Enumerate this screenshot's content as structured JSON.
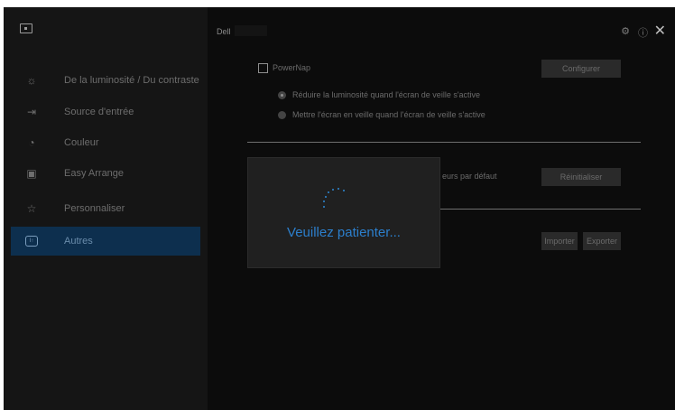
{
  "header": {
    "brand": "Dell"
  },
  "sidebar": {
    "items": [
      {
        "label": "De la luminosité / Du contraste",
        "icon": "brightness-icon"
      },
      {
        "label": "Source d'entrée",
        "icon": "input-source-icon"
      },
      {
        "label": "Couleur",
        "icon": "color-icon"
      },
      {
        "label": "Easy Arrange",
        "icon": "easy-arrange-icon"
      },
      {
        "label": "Personnaliser",
        "icon": "star-icon"
      },
      {
        "label": "Autres",
        "icon": "others-icon"
      }
    ],
    "active": "Autres"
  },
  "powernap": {
    "checkbox_label": "PowerNap",
    "configure_button": "Configurer",
    "option1": "Réduire la luminosité quand l'écran de veille s'active",
    "option2": "Mettre l'écran en veille quand l'écran de veille s'active"
  },
  "reset": {
    "partial_label": "eurs par défaut",
    "button": "Réinitialiser"
  },
  "importexport": {
    "import_button": "Importer",
    "export_button": "Exporter"
  },
  "modal": {
    "message": "Veuillez patienter..."
  },
  "colors": {
    "accent": "#2d8ad6",
    "active_bg": "#0d2f4e"
  }
}
